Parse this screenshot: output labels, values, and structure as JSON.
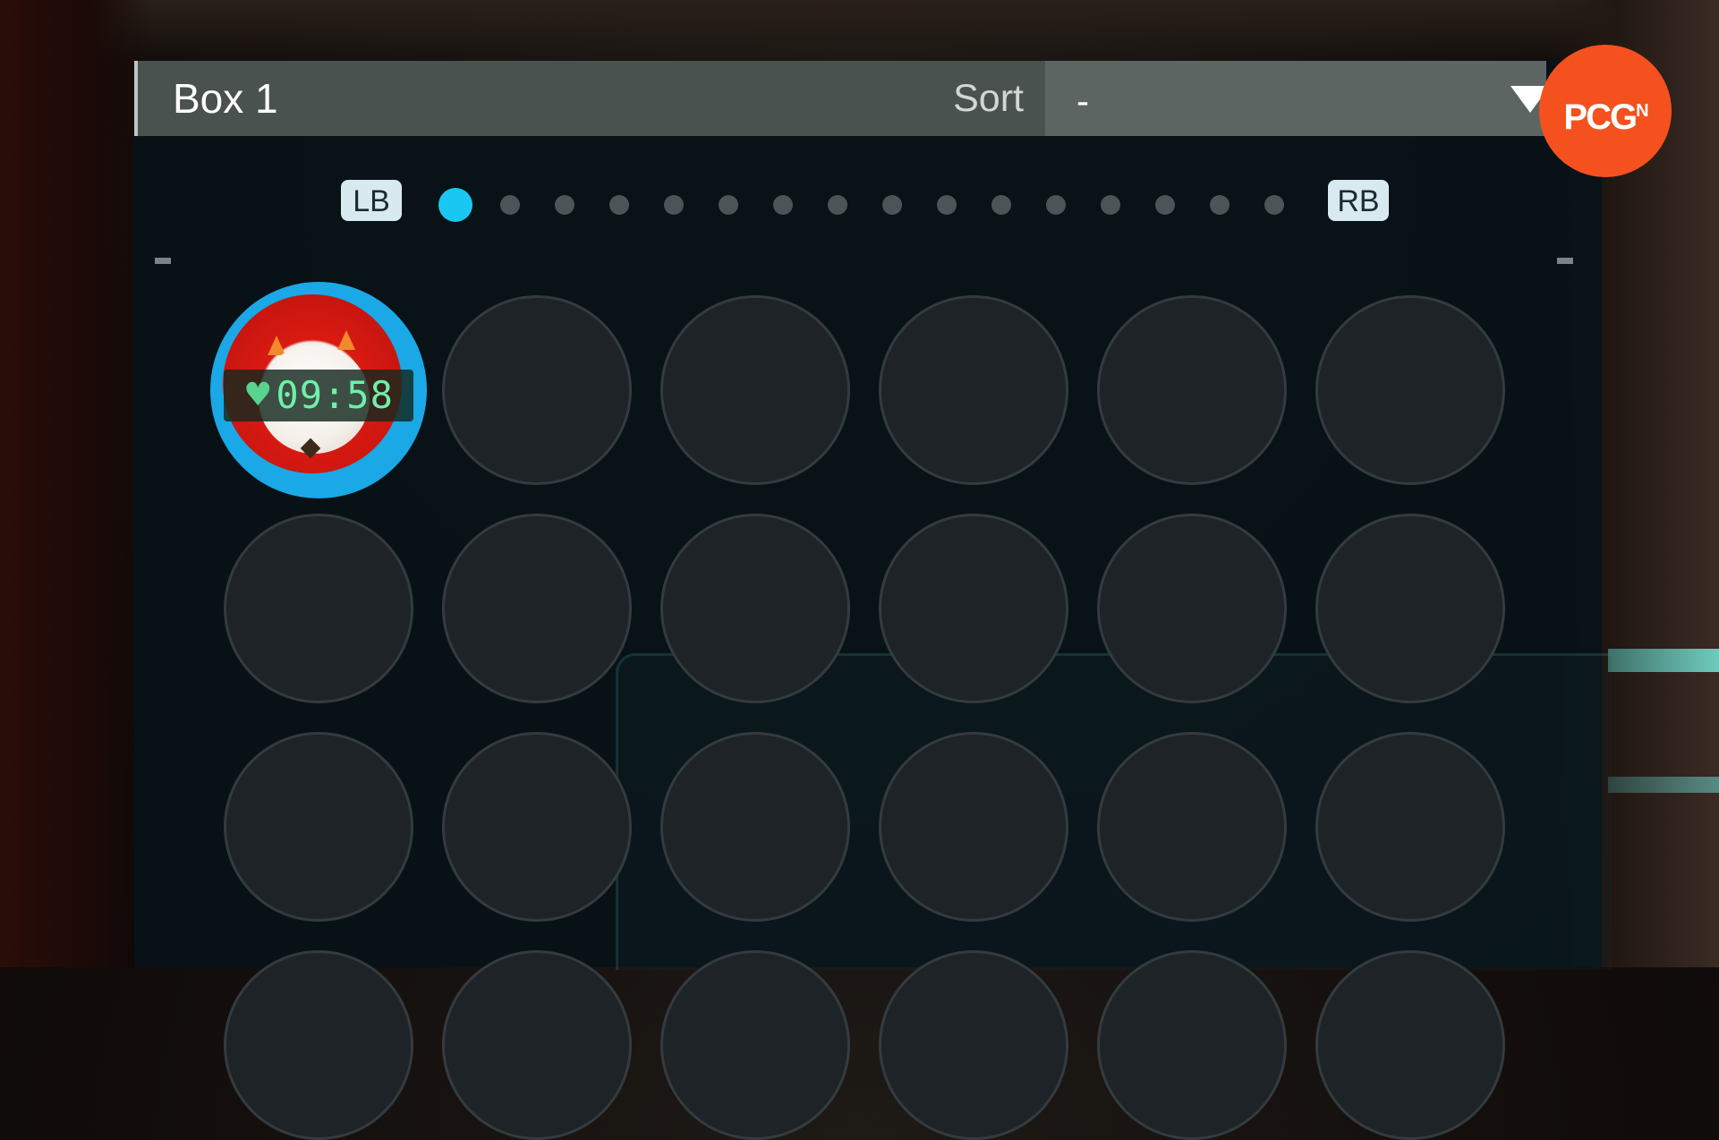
{
  "box": {
    "title": "Box 1"
  },
  "sort": {
    "label": "Sort",
    "value": "-"
  },
  "logo": {
    "text": "PCG",
    "sup": "N"
  },
  "page_nav": {
    "prev_label": "LB",
    "next_label": "RB",
    "page_count": 16,
    "active_page": 1
  },
  "slots": [
    {
      "occupied": true,
      "pal_icon": "white-sheep-pal-icon",
      "timer": "09:58",
      "timer_icon": "heart-icon"
    }
  ],
  "colors": {
    "accent": "#19c7f2",
    "timer_text": "#6ef0a8",
    "logo_bg": "#f4511e"
  }
}
